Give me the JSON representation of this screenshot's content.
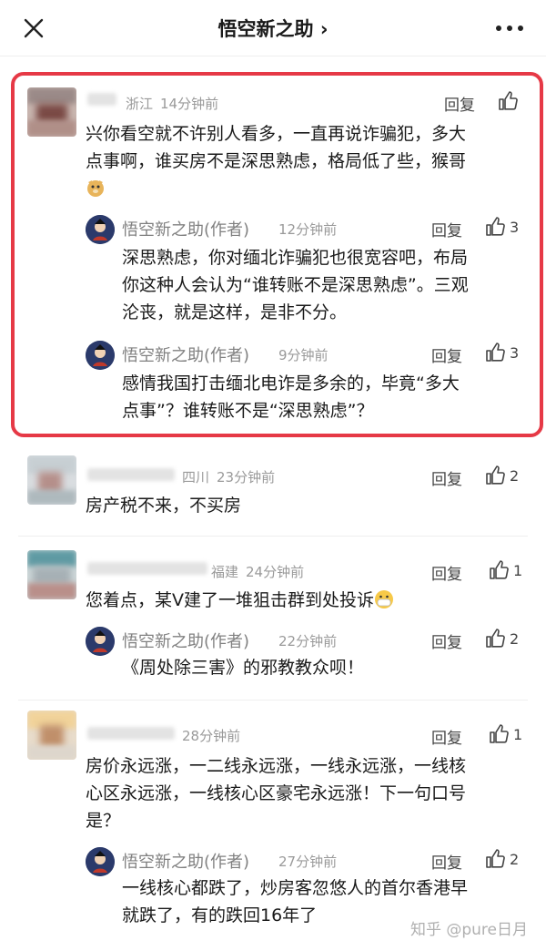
{
  "header": {
    "title": "悟空新之助 ›"
  },
  "reply_label": "回复",
  "comments": [
    {
      "location": "浙江",
      "time": "14分钟前",
      "likes": "",
      "text_lines": [
        "兴你看空就不许别人看多，一直再说诈骗犯，多大",
        "点事啊，谁买房不是深思熟虑，格局低了些，猴哥"
      ],
      "emoji": "doge-emoji",
      "replies": [
        {
          "author": "悟空新之助(作者)",
          "time": "12分钟前",
          "likes": "3",
          "text_lines": [
            "深思熟虑，你对缅北诈骗犯也很宽容吧，布局",
            "你这种人会认为“谁转账不是深思熟虑”。三观",
            "沦丧，就是这样，是非不分。"
          ]
        },
        {
          "author": "悟空新之助(作者)",
          "time": "9分钟前",
          "likes": "3",
          "text_lines": [
            "感情我国打击缅北电诈是多余的，毕竟“多大",
            "点事”？谁转账不是“深思熟虑”？"
          ]
        }
      ]
    },
    {
      "location": "四川",
      "time": "23分钟前",
      "likes": "2",
      "text_lines": [
        "房产税不来，不买房"
      ],
      "replies": []
    },
    {
      "location": "福建",
      "time": "24分钟前",
      "likes": "1",
      "text_lines": [
        "您着点，某V建了一堆狙击群到处投诉"
      ],
      "emoji": "mask-emoji",
      "replies": [
        {
          "author": "悟空新之助(作者)",
          "time": "22分钟前",
          "likes": "2",
          "text_lines": [
            "《周处除三害》的邪教教众呗！"
          ]
        }
      ]
    },
    {
      "location": "",
      "time": "28分钟前",
      "likes": "1",
      "text_lines": [
        "房价永远涨，一二线永远涨，一线永远涨，一线核",
        "心区永远涨，一线核心区豪宅永远涨！下一句口号",
        "是？"
      ],
      "replies": [
        {
          "author": "悟空新之助(作者)",
          "time": "27分钟前",
          "likes": "2",
          "text_lines": [
            "一线核心都跌了，炒房客忽悠人的首尔香港早",
            "就跌了，有的跌回16年了"
          ]
        }
      ]
    }
  ],
  "watermark": "知乎 @pure日月",
  "colors": {
    "highlight": "#e63946",
    "meta": "#9a9a9a",
    "text": "#1a1a1a"
  }
}
